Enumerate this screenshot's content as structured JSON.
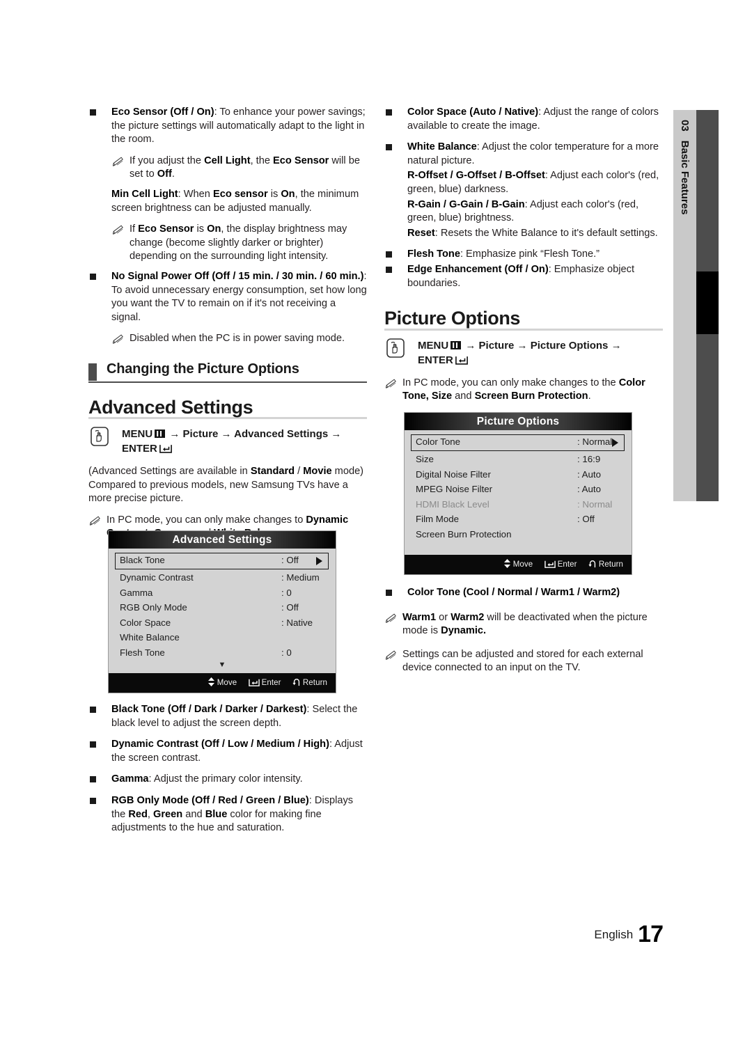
{
  "page": {
    "footer_language": "English",
    "footer_page_number": "17",
    "side_tab_number": "03",
    "side_tab_label": "Basic Features"
  },
  "left_column": {
    "eco_sensor": {
      "bold": "Eco Sensor (Off / On)",
      "rest": ": To enhance your power savings; the picture settings will automatically adapt to the light in the room."
    },
    "eco_sensor_note": {
      "t1": "If you adjust the ",
      "b1": "Cell Light",
      "t2": ", the ",
      "b2": "Eco Sensor",
      "t3": "  will be set to ",
      "b3": "Off",
      "t4": "."
    },
    "min_cell_light": {
      "b1": "Min Cell Light",
      "t1": ": When ",
      "b2": "Eco sensor",
      "t2": " is ",
      "b3": "On",
      "t3": ", the minimum screen brightness can be adjusted manually."
    },
    "min_cell_light_note": {
      "t1": "If ",
      "b1": "Eco Sensor",
      "t2": " is ",
      "b2": "On",
      "t3": ", the display brightness may change (become slightly darker or brighter) depending on the surrounding light intensity."
    },
    "no_signal": {
      "bold": "No Signal Power Off (Off / 15 min. / 30 min. / 60 min.)",
      "rest": ": To avoid unnecessary energy consumption, set how long you want the TV to remain on if it's not receiving a signal."
    },
    "no_signal_note": "Disabled when the PC is in power saving mode.",
    "section_heading": "Changing the Picture Options",
    "advanced_settings_heading": "Advanced Settings",
    "menu_path": {
      "menu": "MENU",
      "arrow": "→",
      "step1": "Picture",
      "step2": "Advanced Settings",
      "enter": "ENTER"
    },
    "availability": {
      "t1": "(Advanced Settings are available in ",
      "b1": "Standard",
      "t2": " / ",
      "b2": "Movie",
      "t3": " mode) Compared to previous models, new Samsung TVs have a more precise picture."
    },
    "pc_mode_note": {
      "t1": "In PC mode, you can only make changes to ",
      "b1": "Dynamic Contrast, Gamma",
      "t2": " and ",
      "b2": "White Balance",
      "t3": "."
    },
    "osd_advanced": {
      "title": "Advanced Settings",
      "rows": [
        {
          "label": "Black Tone",
          "value": ": Off",
          "selected": true,
          "dim": false
        },
        {
          "label": "Dynamic Contrast",
          "value": ": Medium",
          "selected": false,
          "dim": false
        },
        {
          "label": "Gamma",
          "value": ": 0",
          "selected": false,
          "dim": false
        },
        {
          "label": "RGB Only Mode",
          "value": ": Off",
          "selected": false,
          "dim": false
        },
        {
          "label": "Color Space",
          "value": ": Native",
          "selected": false,
          "dim": false
        },
        {
          "label": "White Balance",
          "value": "",
          "selected": false,
          "dim": false
        },
        {
          "label": "Flesh Tone",
          "value": ": 0",
          "selected": false,
          "dim": false
        }
      ],
      "more_caret": "▼",
      "footer": {
        "move": "Move",
        "enter": "Enter",
        "return": "Return"
      }
    },
    "bullets": [
      {
        "bold": "Black Tone (Off / Dark / Darker / Darkest)",
        "rest": ": Select the black level to adjust the screen depth."
      },
      {
        "bold": "Dynamic Contrast (Off / Low / Medium / High)",
        "rest": ": Adjust the screen contrast."
      },
      {
        "bold": "Gamma",
        "rest": ": Adjust the primary color intensity."
      }
    ],
    "rgb_bullet": {
      "b1": "RGB Only Mode (Off / Red / Green / Blue)",
      "t1": ": Displays the ",
      "b2": "Red",
      "t2": ", ",
      "b3": "Green",
      "t3": " and ",
      "b4": "Blue",
      "t4": " color for making fine adjustments to the hue and saturation."
    }
  },
  "right_column": {
    "color_space": {
      "bold": "Color Space (Auto / Native)",
      "rest": ": Adjust the range of colors available to create the image."
    },
    "white_balance": {
      "bold": "White Balance",
      "rest": ": Adjust the color temperature for a more natural picture."
    },
    "offsets": {
      "bold": "R-Offset / G-Offset / B-Offset",
      "rest": ": Adjust each color's (red, green, blue) darkness."
    },
    "gains": {
      "bold": "R-Gain / G-Gain / B-Gain",
      "rest": ": Adjust each color's (red, green, blue) brightness."
    },
    "reset": {
      "bold": "Reset",
      "rest": ": Resets the White Balance to it's default settings."
    },
    "flesh_tone": {
      "bold": "Flesh Tone",
      "rest": ": Emphasize pink “Flesh Tone.”"
    },
    "edge_enhancement": {
      "bold": "Edge Enhancement (Off / On)",
      "rest": ": Emphasize object boundaries."
    },
    "picture_options_heading": "Picture Options",
    "menu_path": {
      "menu": "MENU",
      "arrow": "→",
      "step1": "Picture",
      "step2": "Picture Options",
      "enter": "ENTER"
    },
    "pc_mode_note": {
      "t1": "In PC mode, you can only make changes to the ",
      "b1": "Color Tone, Size",
      "t2": " and ",
      "b2": "Screen Burn Protection",
      "t3": "."
    },
    "osd_picture_options": {
      "title": "Picture Options",
      "rows": [
        {
          "label": "Color Tone",
          "value": ": Normal",
          "selected": true,
          "dim": false
        },
        {
          "label": "Size",
          "value": ": 16:9",
          "selected": false,
          "dim": false
        },
        {
          "label": "Digital Noise Filter",
          "value": ": Auto",
          "selected": false,
          "dim": false
        },
        {
          "label": "MPEG Noise Filter",
          "value": ": Auto",
          "selected": false,
          "dim": false
        },
        {
          "label": "HDMI Black Level",
          "value": ": Normal",
          "selected": false,
          "dim": true
        },
        {
          "label": "Film Mode",
          "value": ": Off",
          "selected": false,
          "dim": false
        },
        {
          "label": "Screen Burn Protection",
          "value": "",
          "selected": false,
          "dim": false
        }
      ],
      "footer": {
        "move": "Move",
        "enter": "Enter",
        "return": "Return"
      }
    },
    "color_tone_bullet": {
      "bold": "Color Tone (Cool / Normal / Warm1 / Warm2)",
      "rest": ""
    },
    "warm_note": {
      "b1": "Warm1",
      "t1": " or ",
      "b2": "Warm2",
      "t2": " will be deactivated when the picture mode is ",
      "b3": "Dynamic.",
      "t3": ""
    },
    "settings_note": "Settings can be adjusted and stored for each external device connected to an input on the TV."
  }
}
